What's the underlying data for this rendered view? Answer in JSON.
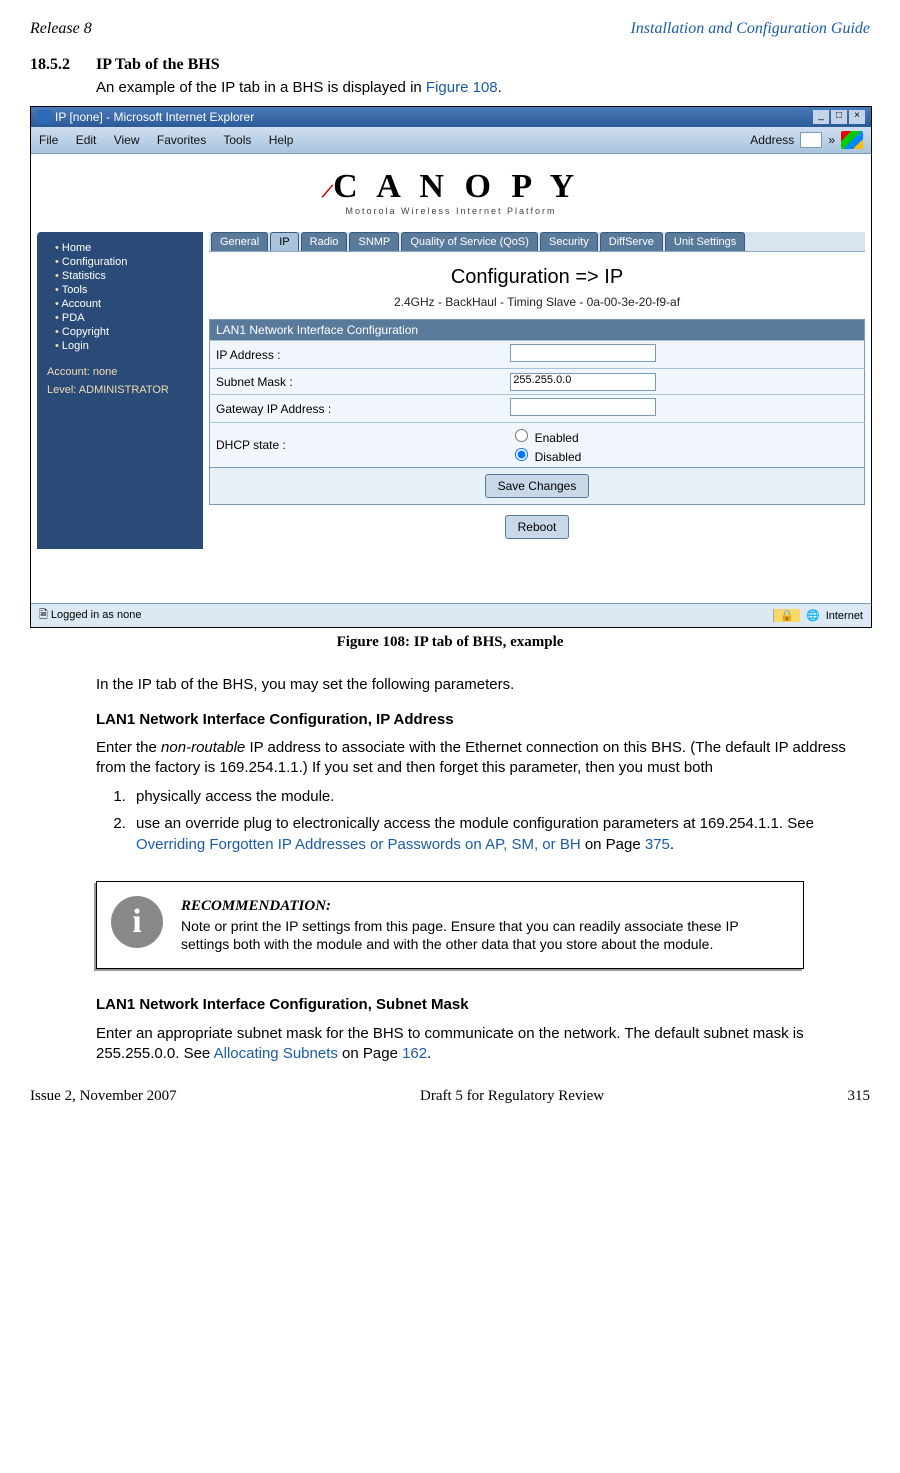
{
  "header": {
    "left": "Release 8",
    "right": "Installation and Configuration Guide"
  },
  "section": {
    "number": "18.5.2",
    "title": "IP Tab of the BHS"
  },
  "intro": {
    "text_a": "An example of the IP tab in a BHS is displayed in ",
    "fig_link": "Figure 108",
    "text_b": "."
  },
  "ie_window": {
    "title": "IP [none] - Microsoft Internet Explorer",
    "menus": [
      "File",
      "Edit",
      "View",
      "Favorites",
      "Tools",
      "Help"
    ],
    "address_label": "Address",
    "chev": "»",
    "status_left": "Logged in as none",
    "status_lock": "🔒",
    "status_globe": "🌐",
    "status_right": "Internet"
  },
  "canopy": {
    "brand": "C A N O P Y",
    "tagline": "Motorola Wireless Internet Platform"
  },
  "sidebar": {
    "items": [
      "Home",
      "Configuration",
      "Statistics",
      "Tools",
      "Account",
      "PDA",
      "Copyright",
      "Login"
    ],
    "account_line1": "Account: none",
    "account_line2": "Level: ADMINISTRATOR"
  },
  "tabs": [
    "General",
    "IP",
    "Radio",
    "SNMP",
    "Quality of Service (QoS)",
    "Security",
    "DiffServe",
    "Unit Settings"
  ],
  "config": {
    "title": "Configuration => IP",
    "subtitle": "2.4GHz - BackHaul - Timing Slave - 0a-00-3e-20-f9-af",
    "table_header": "LAN1 Network Interface Configuration"
  },
  "fields": {
    "ip_label": "IP Address :",
    "ip_value": "",
    "mask_label": "Subnet Mask :",
    "mask_value": "255.255.0.0",
    "gw_label": "Gateway IP Address :",
    "gw_value": "",
    "dhcp_label": "DHCP state :",
    "dhcp_enabled": "Enabled",
    "dhcp_disabled": "Disabled"
  },
  "buttons": {
    "save": "Save Changes",
    "reboot": "Reboot"
  },
  "figure_caption": "Figure 108: IP tab of BHS, example",
  "body1": "In the IP tab of the BHS, you may set the following parameters.",
  "h1": "LAN1 Network Interface Configuration, IP Address",
  "p1a": "Enter the ",
  "p1_em": "non-routable",
  "p1b": " IP address to associate with the Ethernet connection on this BHS. (The default IP address from the factory is 169.254.1.1.) If you set and then forget this parameter, then you must both",
  "list1": {
    "i1": "physically access the module.",
    "i2a": "use an override plug to electronically access the module configuration parameters at 169.254.1.1. See ",
    "i2_link": "Overriding Forgotten IP Addresses or Passwords on AP, SM, or BH",
    "i2b": " on Page ",
    "i2_page": "375",
    "i2c": "."
  },
  "reco": {
    "title": "RECOMMENDATION:",
    "text": "Note or print the IP settings from this page. Ensure that you can readily associate these IP settings both with the module and with the other data that you store about the module.",
    "glyph": "i"
  },
  "h2": "LAN1 Network Interface Configuration, Subnet Mask",
  "p2a": "Enter an appropriate subnet mask for the BHS to communicate on the network. The default subnet mask is 255.255.0.0. See ",
  "p2_link": "Allocating Subnets",
  "p2b": " on Page ",
  "p2_page": "162",
  "p2c": ".",
  "footer": {
    "left": "Issue 2, November 2007",
    "center": "Draft 5 for Regulatory Review",
    "right": "315"
  }
}
